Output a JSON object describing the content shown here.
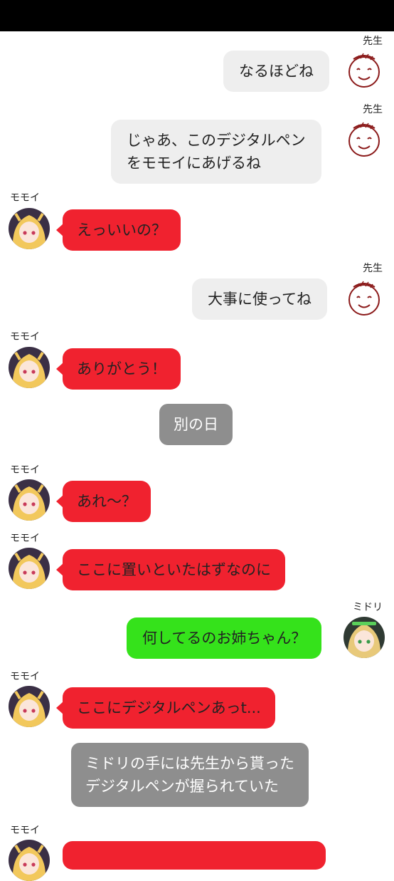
{
  "colors": {
    "sensei_bubble": "#eeeeee",
    "momoi_bubble": "#f0222f",
    "midori_bubble": "#35e21b",
    "narration_bubble": "#8e8e8e",
    "status_bar": "#000000"
  },
  "messages": [
    {
      "speaker": "先生",
      "text": "なるほどね"
    },
    {
      "speaker": "先生",
      "line1": "じゃあ、このデジタルペン",
      "line2": "をモモイにあげるね"
    },
    {
      "speaker": "モモイ",
      "text": "えっいいの？"
    },
    {
      "speaker": "先生",
      "text": "大事に使ってね"
    },
    {
      "speaker": "モモイ",
      "text": "ありがとう！"
    },
    {
      "speaker": "",
      "text": "別の日"
    },
    {
      "speaker": "モモイ",
      "text": "あれ～？"
    },
    {
      "speaker": "モモイ",
      "text": "ここに置いといたはずなのに"
    },
    {
      "speaker": "ミドリ",
      "text": "何してるのお姉ちゃん？"
    },
    {
      "speaker": "モモイ",
      "text": "ここにデジタルペンあっt..."
    },
    {
      "speaker": "",
      "line1": "ミドリの手には先生から貰った",
      "line2": "デジタルペンが握られていた"
    },
    {
      "speaker": "モモイ",
      "text": ""
    }
  ]
}
